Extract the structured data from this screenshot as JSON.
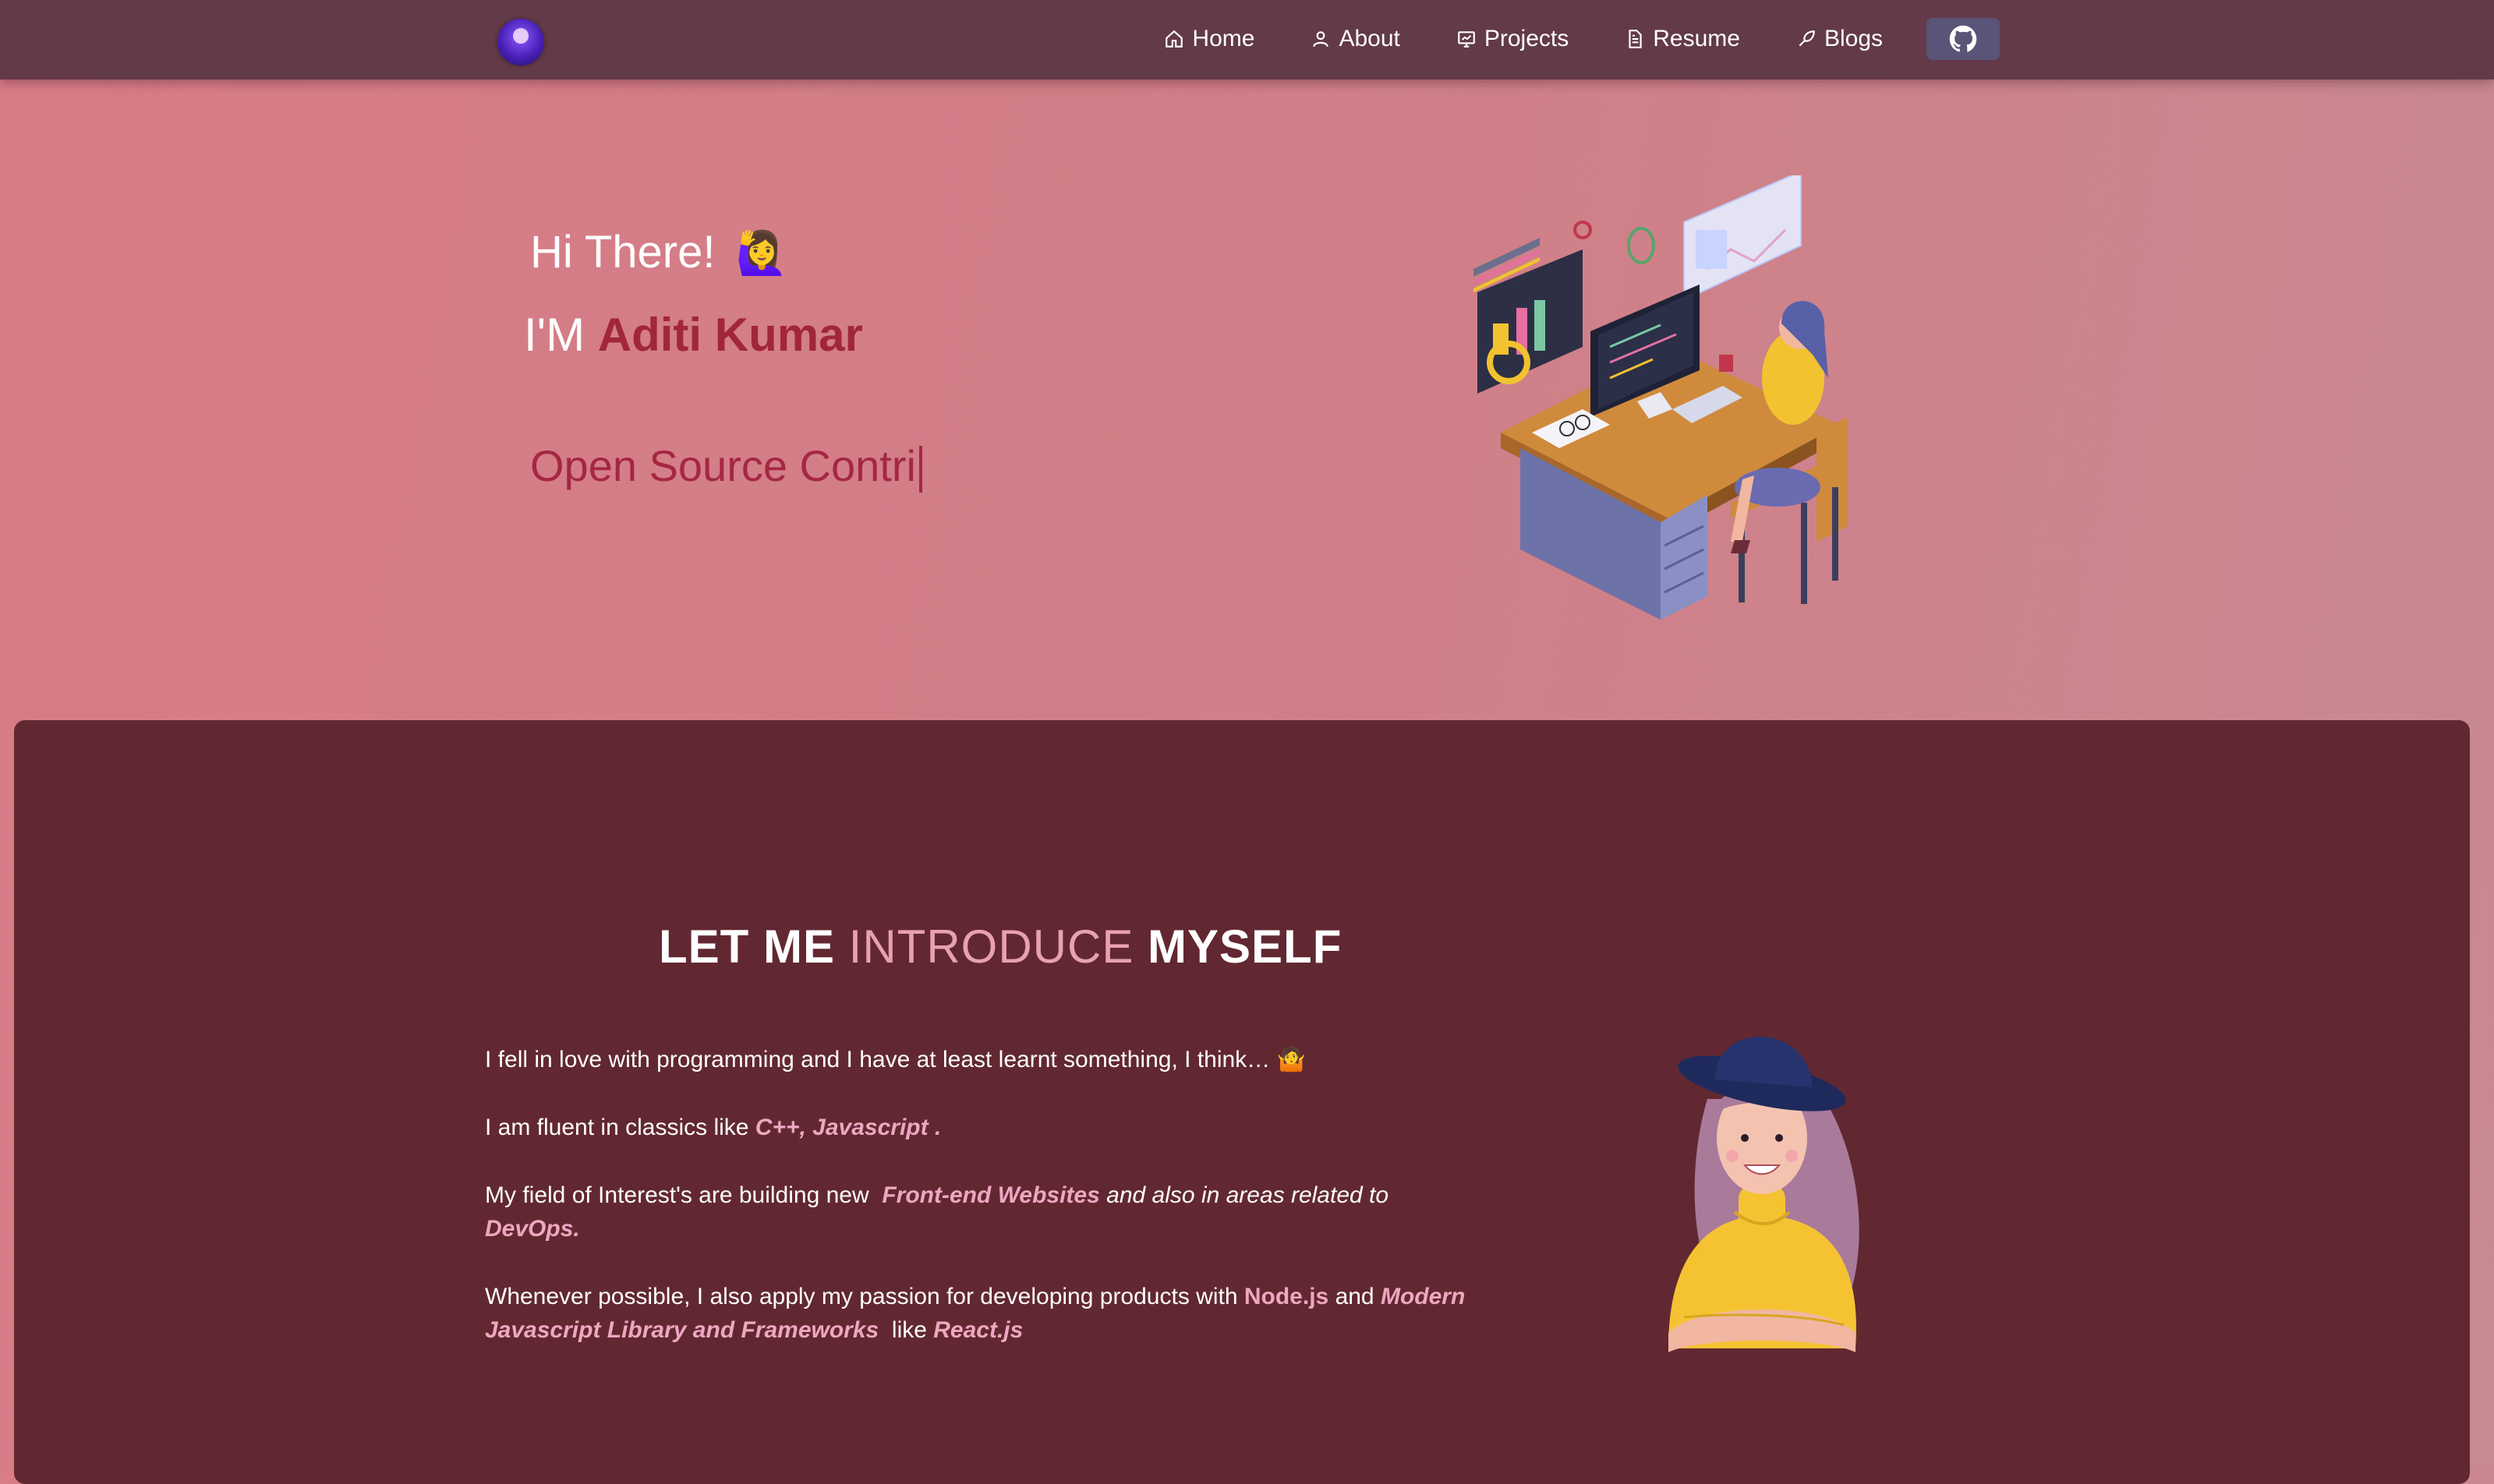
{
  "nav": {
    "items": [
      {
        "label": "Home",
        "icon": "home-icon"
      },
      {
        "label": "About",
        "icon": "user-icon"
      },
      {
        "label": "Projects",
        "icon": "projects-icon"
      },
      {
        "label": "Resume",
        "icon": "document-icon"
      },
      {
        "label": "Blogs",
        "icon": "blog-icon"
      }
    ],
    "github_icon": "github-icon"
  },
  "hero": {
    "greeting": "Hi There!",
    "wave_emoji": "🙋‍♀️",
    "intro_prefix": "I'M",
    "name": "Aditi Kumar",
    "typewriter_text": "Open Source Contri"
  },
  "about": {
    "title_part1": "LET ME",
    "title_accent": "INTRODUCE",
    "title_part2": "MYSELF",
    "p1_text": "I fell in love with programming and I have at least learnt something, I think…",
    "p1_emoji": "🤷",
    "p2_text": "I am fluent in classics like",
    "p2_highlight": "C++, Javascript .",
    "p3_text": "My field of Interest's are building new",
    "p3_highlight1": "Front-end Websites",
    "p3_middle": "and also in areas related to",
    "p3_highlight2": "DevOps.",
    "p4_text": "Whenever possible, I also apply my passion for developing products with",
    "p4_highlight1": "Node.js",
    "p4_and": "and",
    "p4_highlight2": "Modern Javascript Library and Frameworks",
    "p4_like": "like",
    "p4_highlight3": "React.js"
  },
  "colors": {
    "navbar": "#633a47",
    "hero_bg": "#d87c86",
    "accent_dark": "#a1263c",
    "about_bg": "#622831",
    "accent_light": "#eea7c0"
  }
}
